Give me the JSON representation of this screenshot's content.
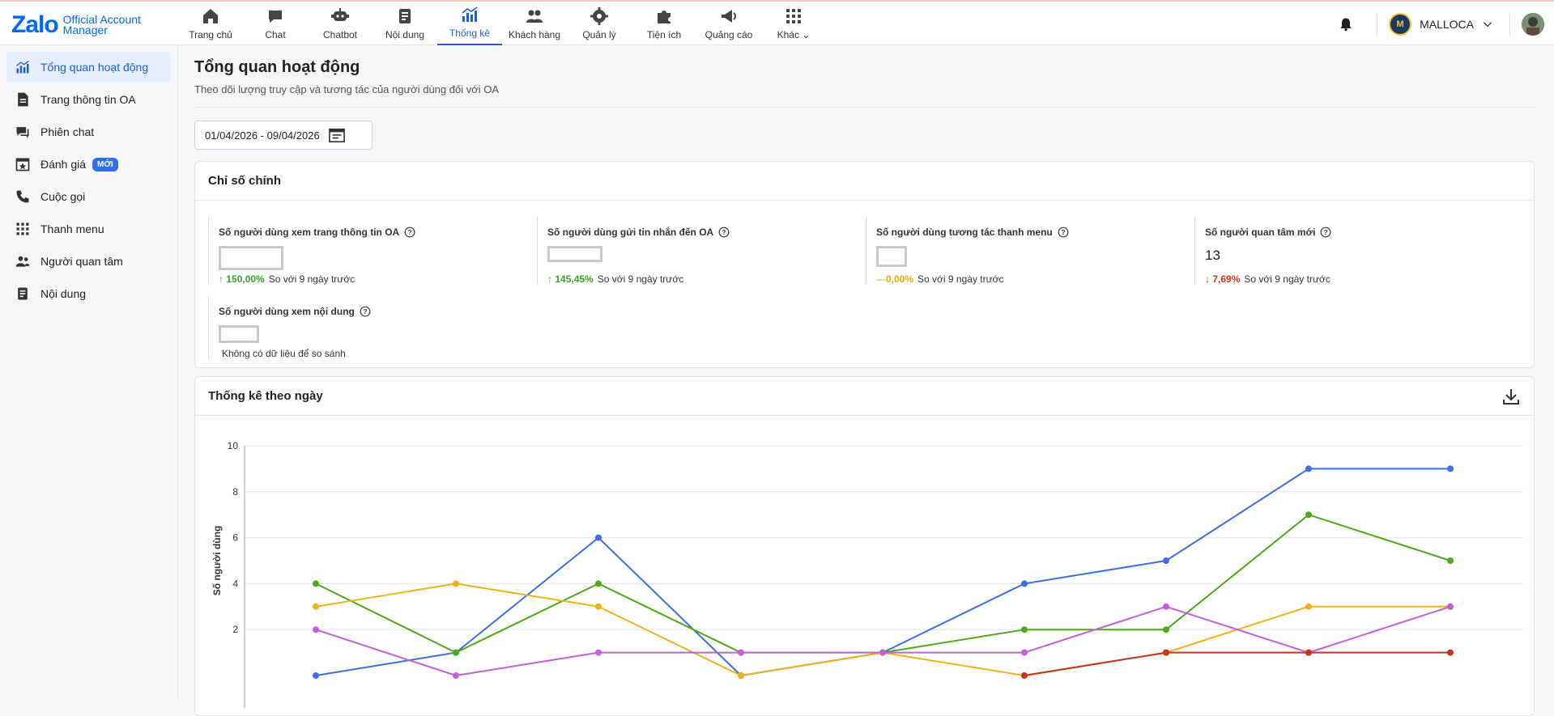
{
  "app": {
    "logo_main": "Zalo",
    "logo_sub_1": "Official Account",
    "logo_sub_2": "Manager"
  },
  "nav": [
    {
      "label": "Trang chủ",
      "icon": "home-icon"
    },
    {
      "label": "Chat",
      "icon": "chat-icon"
    },
    {
      "label": "Chatbot",
      "icon": "chatbot-icon"
    },
    {
      "label": "Nội dung",
      "icon": "content-icon"
    },
    {
      "label": "Thống kê",
      "icon": "stats-icon",
      "active": true
    },
    {
      "label": "Khách hàng",
      "icon": "customers-icon"
    },
    {
      "label": "Quản lý",
      "icon": "gear-icon"
    },
    {
      "label": "Tiện ích",
      "icon": "puzzle-icon"
    },
    {
      "label": "Quảng cáo",
      "icon": "ads-icon"
    },
    {
      "label": "Khác",
      "icon": "grid-icon"
    }
  ],
  "account": {
    "avatar_letter": "M",
    "name": "MALLOCA"
  },
  "sidebar": {
    "items": [
      {
        "label": "Tổng quan hoạt động",
        "icon": "chart-bars-icon",
        "active": true
      },
      {
        "label": "Trang thông tin OA",
        "icon": "document-icon"
      },
      {
        "label": "Phiên chat",
        "icon": "chat-bubbles-icon"
      },
      {
        "label": "Đánh giá",
        "icon": "rating-star-icon",
        "badge": "MỚI"
      },
      {
        "label": "Cuộc gọi",
        "icon": "phone-icon"
      },
      {
        "label": "Thanh menu",
        "icon": "grid-icon"
      },
      {
        "label": "Người quan tâm",
        "icon": "users-icon"
      },
      {
        "label": "Nội dung",
        "icon": "content-icon"
      }
    ]
  },
  "page": {
    "title": "Tổng quan hoạt động",
    "description": "Theo dõi lượng truy cập và tương tác của người dùng đối với OA",
    "date_range": "01/04/2026 - 09/04/2026"
  },
  "key_metrics": {
    "title": "Chỉ số chính",
    "compare_text": "So với 9 ngày trước",
    "items": [
      {
        "label": "Số người dùng xem trang thông tin OA",
        "value": "",
        "change": "150,00%",
        "trend": "up"
      },
      {
        "label": "Số người dùng gửi tin nhắn đến OA",
        "value": "",
        "change": "145,45%",
        "trend": "up"
      },
      {
        "label": "Số người dùng tương tác thanh menu",
        "value": "",
        "change": "0,00%",
        "trend": "flat"
      },
      {
        "label": "Số người quan tâm mới",
        "value": "13",
        "change": "7,69%",
        "trend": "down"
      },
      {
        "label": "Số người dùng xem nội dung",
        "value": "",
        "no_compare": "Không có dữ liệu để so sánh"
      }
    ]
  },
  "daily_stats": {
    "title": "Thống kê theo ngày"
  },
  "chart_data": {
    "type": "line",
    "title": "",
    "xlabel": "",
    "ylabel": "Số người dùng",
    "ylim": [
      0,
      10
    ],
    "yticks": [
      "10",
      "8",
      "6",
      "4",
      "2"
    ],
    "grid": true,
    "x": [
      1,
      2,
      3,
      4,
      5,
      6,
      7,
      8,
      9
    ],
    "series": [
      {
        "color": "#3b6ee8",
        "values": [
          0,
          1,
          6,
          0,
          1,
          4,
          5,
          9,
          9
        ]
      },
      {
        "color": "#4caa17",
        "values": [
          4,
          1,
          4,
          1,
          1,
          2,
          2,
          7,
          5
        ]
      },
      {
        "color": "#f0b21a",
        "values": [
          3,
          4,
          3,
          0,
          1,
          0,
          1,
          3,
          3
        ]
      },
      {
        "color": "#c35fd8",
        "values": [
          2,
          0,
          1,
          1,
          1,
          1,
          3,
          1,
          3
        ]
      },
      {
        "color": "#c8321a",
        "values": [
          null,
          null,
          null,
          null,
          null,
          0,
          1,
          1,
          1
        ]
      }
    ]
  }
}
